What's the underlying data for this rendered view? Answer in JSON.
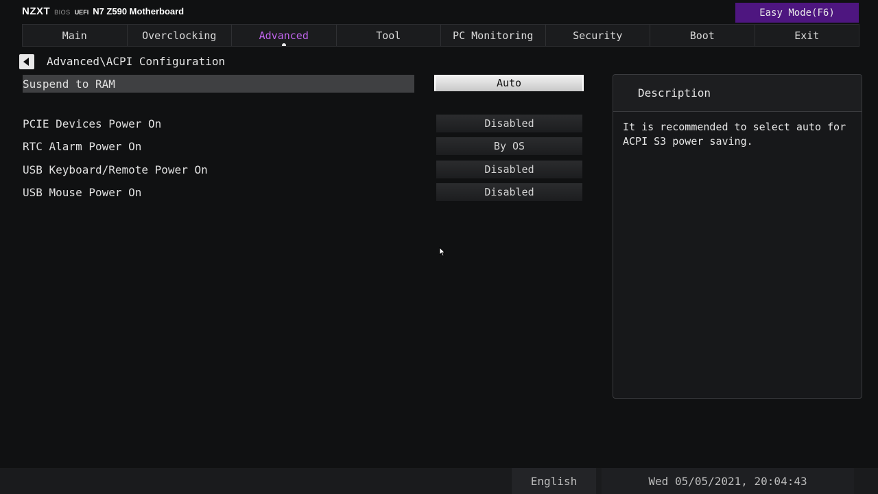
{
  "brand": {
    "logo": "NZXT",
    "bios": "BIOS",
    "uefi": "UEFI",
    "model": "N7 Z590 Motherboard"
  },
  "header": {
    "easy_mode_label": "Easy Mode(F6)"
  },
  "tabs": [
    {
      "label": "Main",
      "active": false
    },
    {
      "label": "Overclocking",
      "active": false
    },
    {
      "label": "Advanced",
      "active": true
    },
    {
      "label": "Tool",
      "active": false
    },
    {
      "label": "PC Monitoring",
      "active": false
    },
    {
      "label": "Security",
      "active": false
    },
    {
      "label": "Boot",
      "active": false
    },
    {
      "label": "Exit",
      "active": false
    }
  ],
  "breadcrumb": "Advanced\\ACPI Configuration",
  "settings": [
    {
      "label": "Suspend to RAM",
      "value": "Auto",
      "selected": true
    },
    {
      "label": "PCIE Devices Power On",
      "value": "Disabled",
      "selected": false
    },
    {
      "label": "RTC Alarm Power On",
      "value": "By OS",
      "selected": false
    },
    {
      "label": "USB Keyboard/Remote Power On",
      "value": "Disabled",
      "selected": false
    },
    {
      "label": "USB Mouse Power On",
      "value": "Disabled",
      "selected": false
    }
  ],
  "description": {
    "title": "Description",
    "text": "It is recommended to select auto for\nACPI S3 power saving."
  },
  "status": {
    "language": "English",
    "datetime": "Wed 05/05/2021, 20:04:43"
  },
  "colors": {
    "accent": "#c165ee",
    "easy_mode_bg": "#4e1680",
    "background": "#101112"
  }
}
